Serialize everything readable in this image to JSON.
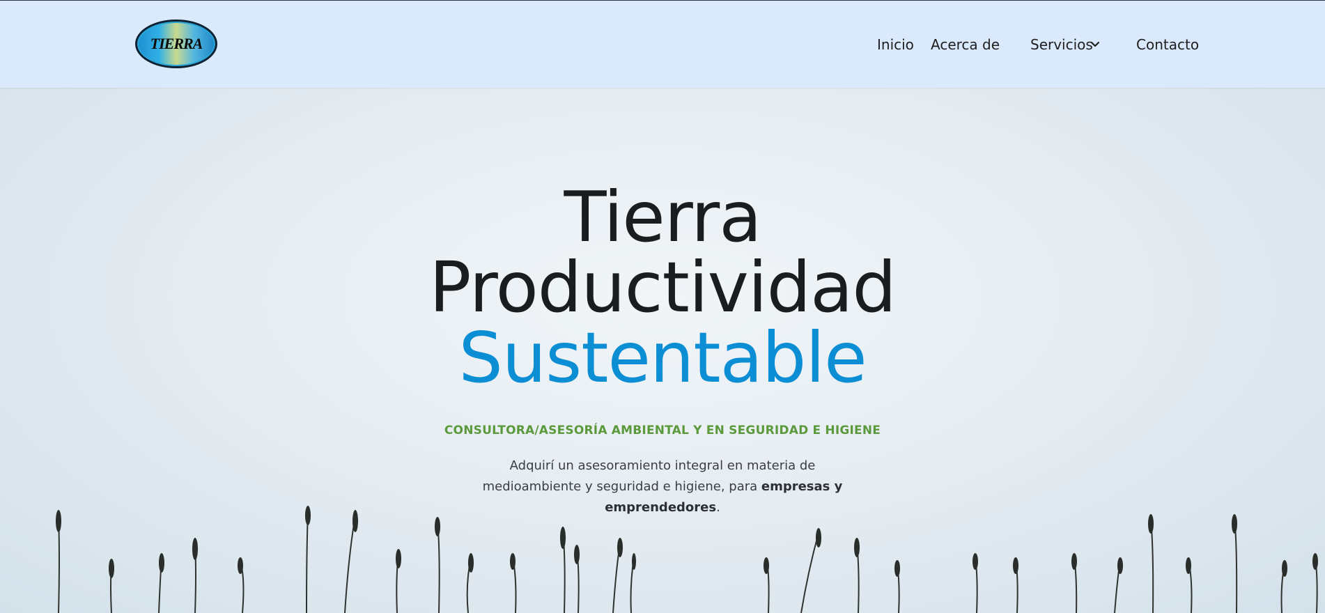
{
  "header": {
    "logo_text": "TIERRA",
    "nav": {
      "inicio": "Inicio",
      "acerca": "Acerca de",
      "servicios": "Servicios",
      "contacto": "Contacto"
    }
  },
  "hero": {
    "title_line1": "Tierra",
    "title_line2": "Productividad",
    "title_line3": "Sustentable",
    "subtitle": "CONSULTORA/ASESORÍA AMBIENTAL Y EN SEGURIDAD E HIGIENE",
    "desc_part1": "Adquirí un asesoramiento integral en materia de medioambiente y seguridad e higiene, para ",
    "desc_bold": "empresas y emprendedores",
    "desc_end": "."
  },
  "colors": {
    "header_bg": "#dbe9fd",
    "title_accent": "#0b8ed4",
    "subtitle": "#5b9a3c"
  },
  "icons": {
    "dropdown": "chevron-down-icon",
    "background": "grass-silhouette"
  }
}
